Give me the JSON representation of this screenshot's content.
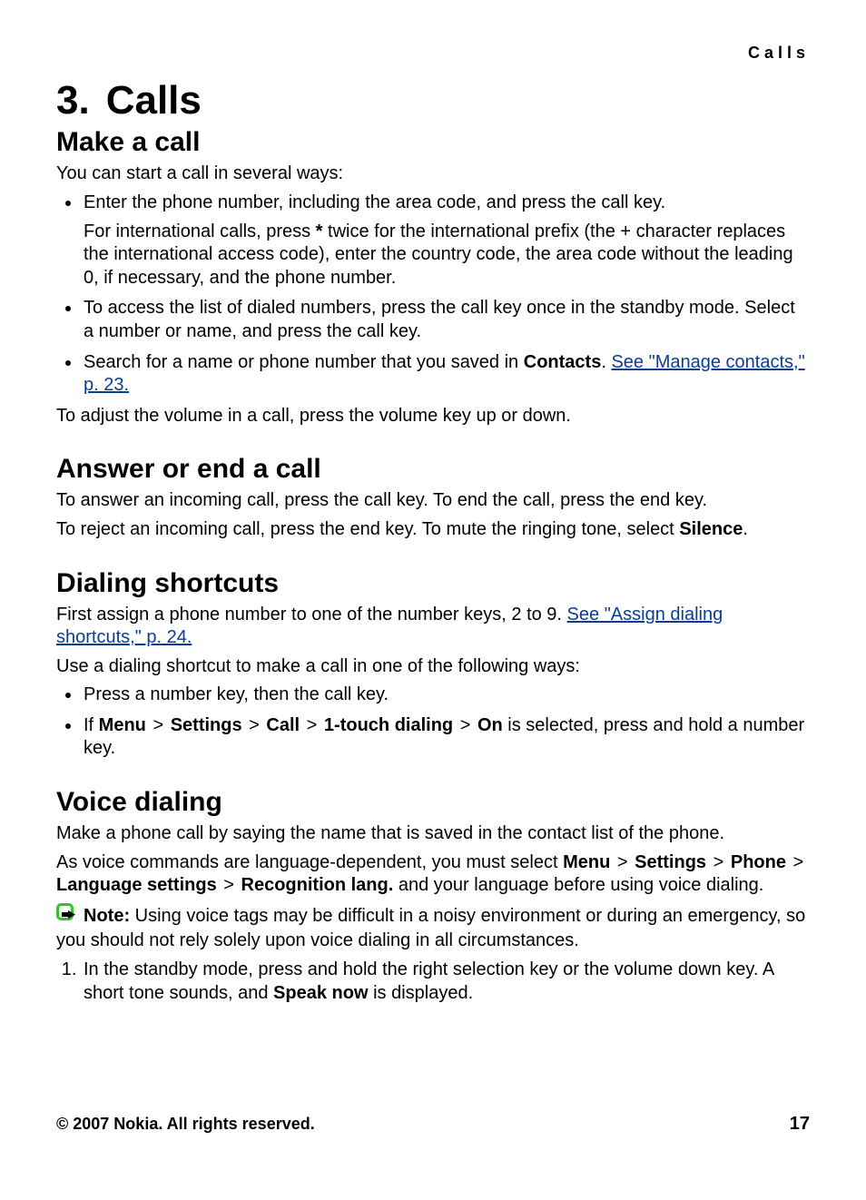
{
  "runningHead": "Calls",
  "chapter": {
    "number": "3.",
    "title": "Calls"
  },
  "makeCall": {
    "heading": "Make a call",
    "intro": "You can start a call in several ways:",
    "items": [
      {
        "line": "Enter the phone number, including the area code, and press the call key.",
        "subPre": "For international calls, press ",
        "subBold": "*",
        "subPost": " twice for the international prefix (the + character replaces the international access code), enter the country code, the area code without the leading 0, if necessary, and the phone number."
      },
      {
        "line": "To access the list of dialed numbers, press the call key once in the standby mode. Select a number or name, and press the call key."
      },
      {
        "pre": "Search for a name or phone number that you saved in ",
        "bold": "Contacts",
        "post": ". ",
        "link": "See \"Manage contacts,\" p. 23."
      }
    ],
    "afterList": "To adjust the volume in a call, press the volume key up or down."
  },
  "answerEnd": {
    "heading": "Answer or end a call",
    "p1": "To answer an incoming call, press the call key. To end the call, press the end key.",
    "p2pre": "To reject an incoming call, press the end key. To mute the ringing tone, select ",
    "p2bold": "Silence",
    "p2post": "."
  },
  "dialShort": {
    "heading": "Dialing shortcuts",
    "p1pre": "First assign a phone number to one of the number keys, 2 to 9. ",
    "p1link": "See \"Assign dialing shortcuts,\" p. 24.",
    "p2": "Use a dialing shortcut to make a call in one of the following ways:",
    "items": {
      "i1": "Press a number key, then the call key.",
      "i2": {
        "pre": "If ",
        "path": [
          "Menu",
          "Settings",
          "Call",
          "1-touch dialing",
          "On"
        ],
        "sep": ">",
        "post": " is selected, press and hold a number key."
      }
    }
  },
  "voice": {
    "heading": "Voice dialing",
    "p1": "Make a phone call by saying the name that is saved in the contact list of the phone.",
    "p2": {
      "pre": "As voice commands are language-dependent, you must select ",
      "path": [
        "Menu",
        "Settings",
        "Phone",
        "Language settings",
        "Recognition lang."
      ],
      "sep": ">",
      "post": " and your language before using voice dialing."
    },
    "note": {
      "label": "Note:",
      "text": "  Using voice tags may be difficult in a noisy environment or during an emergency, so you should not rely solely upon voice dialing in all circumstances."
    },
    "step1": {
      "pre": "In the standby mode, press and hold the right selection key or the volume down key. A short tone sounds, and ",
      "bold": "Speak now",
      "post": " is displayed."
    }
  },
  "footer": {
    "copyright": "© 2007 Nokia. All rights reserved.",
    "page": "17"
  }
}
